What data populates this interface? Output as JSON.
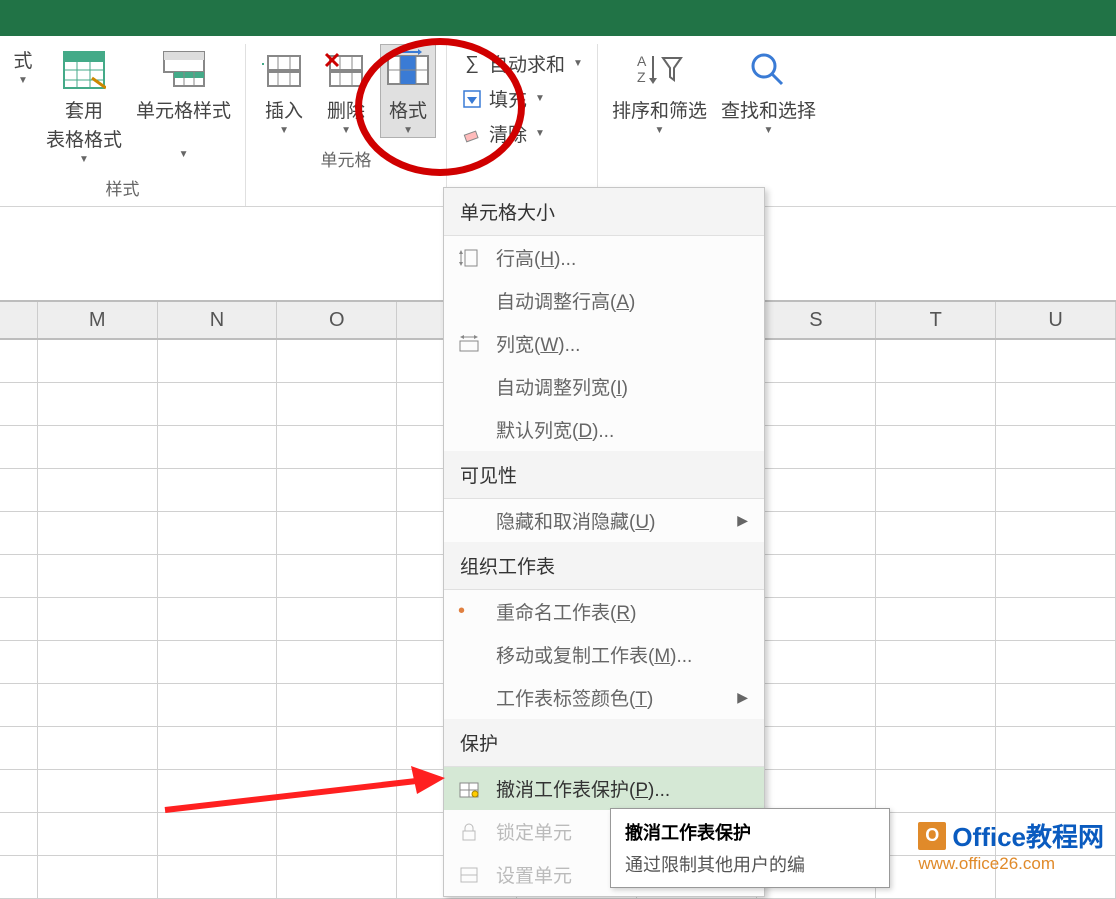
{
  "ribbon": {
    "styles": {
      "apply_table": "套用",
      "table_format": "表格格式",
      "cell_styles": "单元格样式",
      "group": "样式"
    },
    "cells": {
      "insert": "插入",
      "delete": "删除",
      "format": "格式",
      "group": "单元格"
    },
    "editing": {
      "autosum": "自动求和",
      "fill": "填充",
      "clear": "清除",
      "sort": "排序和筛选",
      "find": "查找和选择"
    },
    "partial": "式"
  },
  "columns": [
    "M",
    "N",
    "O",
    "",
    "",
    "",
    "S",
    "T",
    "U"
  ],
  "menu": {
    "hdr_cellsize": "单元格大小",
    "row_height": "行高(H)...",
    "auto_row": "自动调整行高(A)",
    "col_width": "列宽(W)...",
    "auto_col": "自动调整列宽(I)",
    "default_width": "默认列宽(D)...",
    "hdr_vis": "可见性",
    "hide": "隐藏和取消隐藏(U)",
    "hdr_org": "组织工作表",
    "rename": "重命名工作表(R)",
    "move": "移动或复制工作表(M)...",
    "tabcolor": "工作表标签颜色(T)",
    "hdr_prot": "保护",
    "unprotect": "撤消工作表保护(P)...",
    "lockcell": "锁定单元格",
    "setcell": "设置单元格"
  },
  "tooltip": {
    "title": "撤消工作表保护",
    "body": "通过限制其他用户的编"
  },
  "watermark": {
    "line1": "Office教程网",
    "line2": "www.office26.com"
  }
}
